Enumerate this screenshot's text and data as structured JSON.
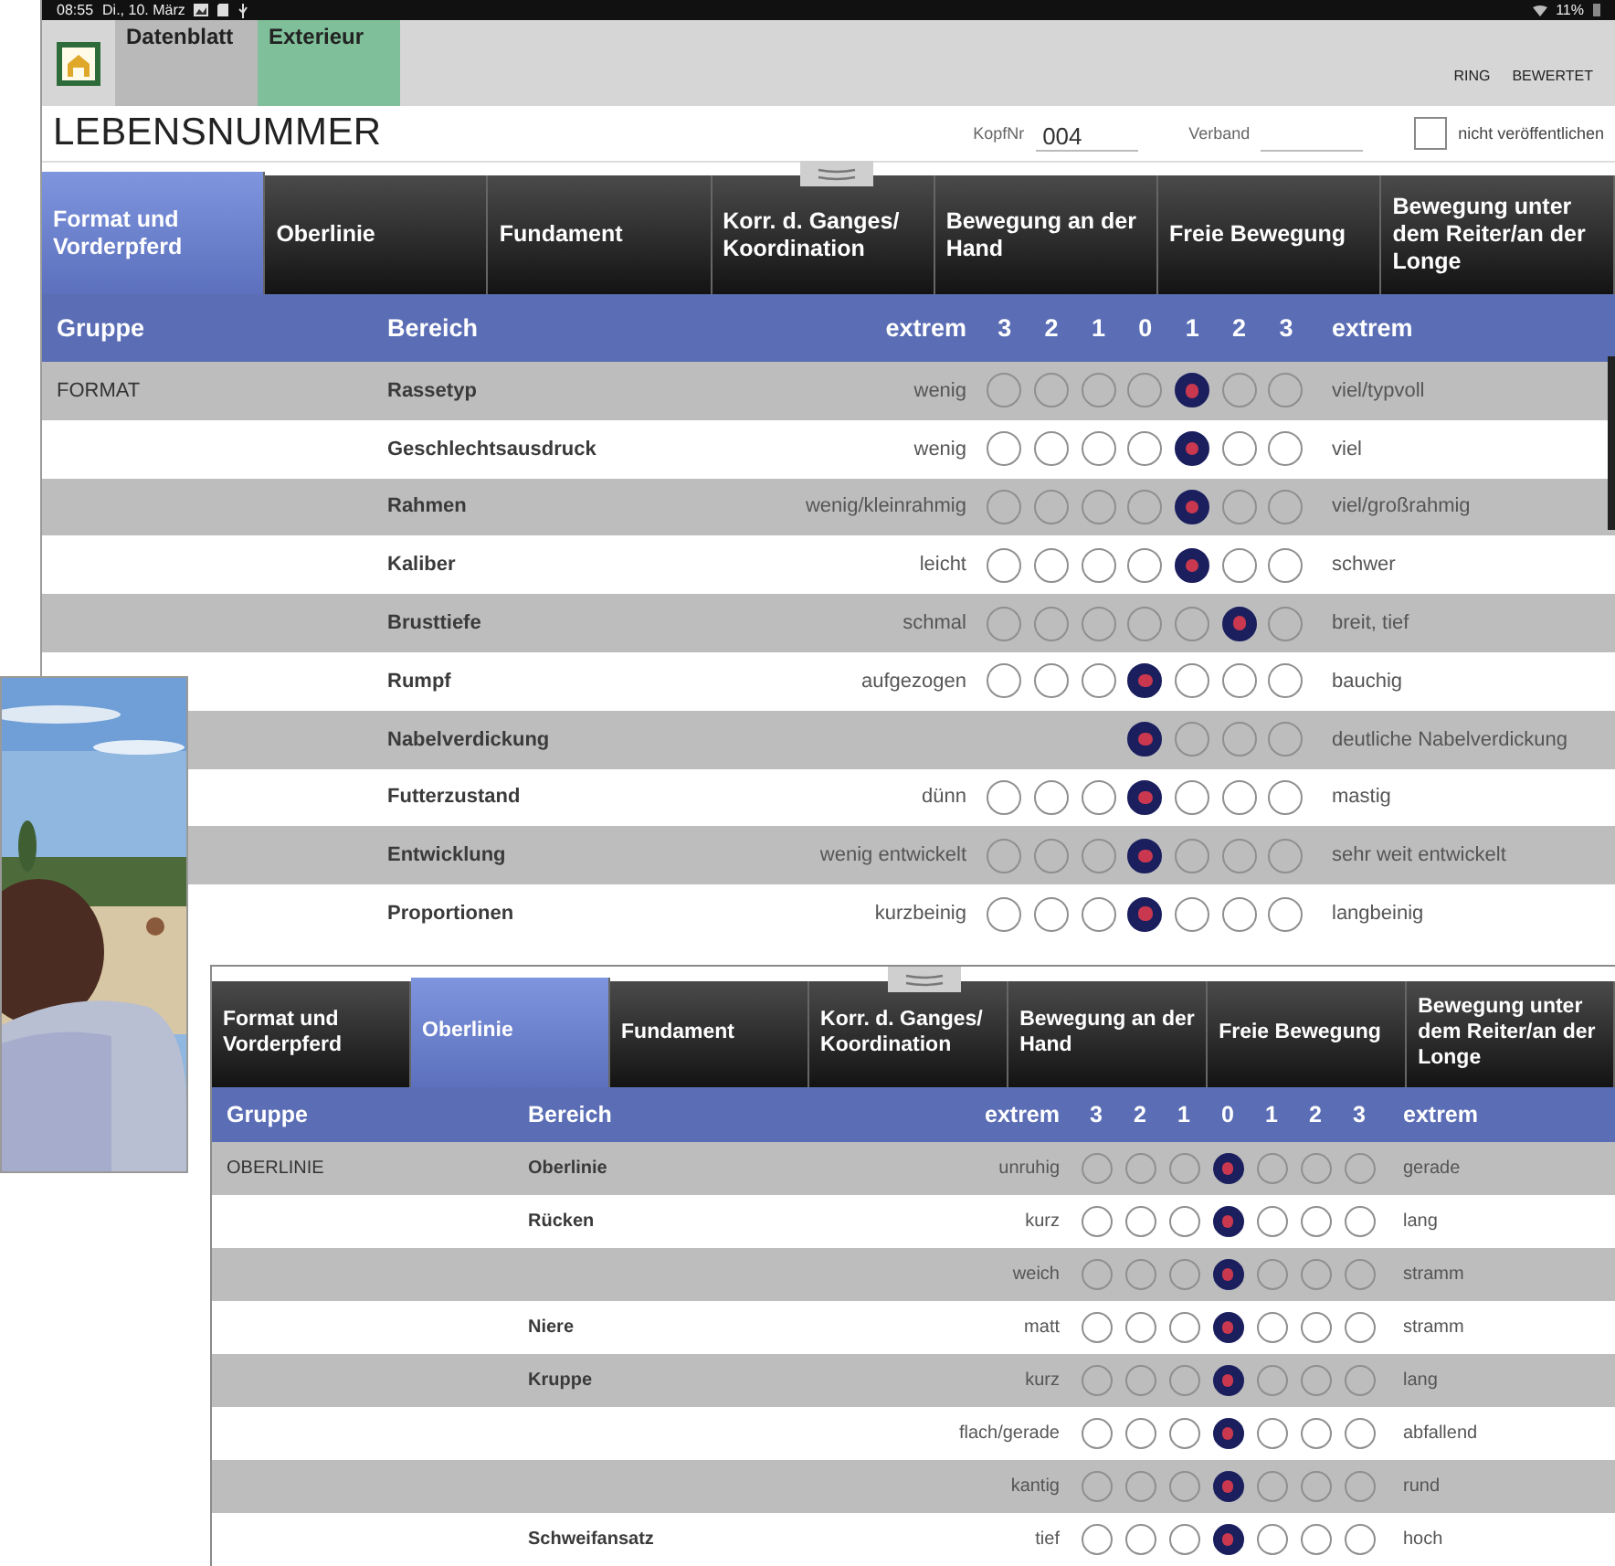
{
  "status_bar": {
    "time": "08:55",
    "date": "Di., 10. März",
    "battery": "11%"
  },
  "main_screen": {
    "app_bar": {
      "nav_tabs": [
        {
          "label": "Datenblatt",
          "selected": false
        },
        {
          "label": "Exterieur",
          "selected": true
        }
      ],
      "actions": [
        "RING",
        "BEWERTET"
      ]
    },
    "record": {
      "title": "LEBENSNUMMER",
      "kopfnr_label": "KopfNr",
      "kopfnr_value": "004",
      "verband_label": "Verband",
      "publish_checkbox": {
        "label": "nicht veröffentlichen",
        "checked": false
      }
    },
    "tabs": [
      {
        "label": "Format und Vorderpferd",
        "selected": true
      },
      {
        "label": "Oberlinie",
        "selected": false
      },
      {
        "label": "Fundament",
        "selected": false
      },
      {
        "label": "Korr. d. Ganges/ Koordination",
        "selected": false
      },
      {
        "label": "Bewegung an der Hand",
        "selected": false
      },
      {
        "label": "Freie Bewegung",
        "selected": false
      },
      {
        "label": "Bewegung unter dem Reiter/an der Longe",
        "selected": false
      }
    ],
    "table": {
      "header": {
        "group": "Gruppe",
        "area": "Bereich",
        "scale": [
          "extrem",
          "3",
          "2",
          "1",
          "0",
          "1",
          "2",
          "3",
          "extrem"
        ]
      },
      "rows": [
        {
          "group": "FORMAT",
          "area": "Rassetyp",
          "low": "wenig",
          "high": "viel/typvoll",
          "options": [
            {
              "selected": false
            },
            {
              "selected": false
            },
            {
              "selected": false
            },
            {
              "selected": false
            },
            {
              "selected": true
            },
            {
              "selected": false
            },
            {
              "selected": false
            }
          ]
        },
        {
          "area": "Geschlechtsausdruck",
          "low": "wenig",
          "high": "viel",
          "options": [
            {
              "selected": false
            },
            {
              "selected": false
            },
            {
              "selected": false
            },
            {
              "selected": false
            },
            {
              "selected": true
            },
            {
              "selected": false
            },
            {
              "selected": false
            }
          ]
        },
        {
          "area": "Rahmen",
          "low": "wenig/kleinrahmig",
          "high": "viel/großrahmig",
          "options": [
            {
              "selected": false
            },
            {
              "selected": false
            },
            {
              "selected": false
            },
            {
              "selected": false
            },
            {
              "selected": true
            },
            {
              "selected": false
            },
            {
              "selected": false
            }
          ]
        },
        {
          "area": "Kaliber",
          "low": "leicht",
          "high": "schwer",
          "options": [
            {
              "selected": false
            },
            {
              "selected": false
            },
            {
              "selected": false
            },
            {
              "selected": false
            },
            {
              "selected": true
            },
            {
              "selected": false
            },
            {
              "selected": false
            }
          ]
        },
        {
          "area": "Brusttiefe",
          "low": "schmal",
          "high": "breit, tief",
          "options": [
            {
              "selected": false
            },
            {
              "selected": false
            },
            {
              "selected": false
            },
            {
              "selected": false
            },
            {
              "selected": false
            },
            {
              "selected": true
            },
            {
              "selected": false
            }
          ]
        },
        {
          "area": "Rumpf",
          "low": "aufgezogen",
          "high": "bauchig",
          "options": [
            {
              "selected": false
            },
            {
              "selected": false
            },
            {
              "selected": false
            },
            {
              "selected": true
            },
            {
              "selected": false
            },
            {
              "selected": false
            },
            {
              "selected": false
            }
          ]
        },
        {
          "area": "Nabelverdickung",
          "high": "deutliche Nabelverdickung",
          "options": [
            {
              "selected": true
            },
            {
              "selected": false
            },
            {
              "selected": false
            },
            {
              "selected": false
            }
          ]
        },
        {
          "area": "Futterzustand",
          "low": "dünn",
          "high": "mastig",
          "options": [
            {
              "selected": false
            },
            {
              "selected": false
            },
            {
              "selected": false
            },
            {
              "selected": true
            },
            {
              "selected": false
            },
            {
              "selected": false
            },
            {
              "selected": false
            }
          ]
        },
        {
          "area": "Entwicklung",
          "low": "wenig entwickelt",
          "high": "sehr weit entwickelt",
          "options": [
            {
              "selected": false
            },
            {
              "selected": false
            },
            {
              "selected": false
            },
            {
              "selected": true
            },
            {
              "selected": false
            },
            {
              "selected": false
            },
            {
              "selected": false
            }
          ]
        },
        {
          "area": "Proportionen",
          "low": "kurzbeinig",
          "high": "langbeinig",
          "options": [
            {
              "selected": false
            },
            {
              "selected": false
            },
            {
              "selected": false
            },
            {
              "selected": true
            },
            {
              "selected": false
            },
            {
              "selected": false
            },
            {
              "selected": false
            }
          ]
        }
      ]
    }
  },
  "overlay_screen": {
    "tabs": [
      {
        "label": "Format und Vorderpferd",
        "selected": false
      },
      {
        "label": "Oberlinie",
        "selected": true
      },
      {
        "label": "Fundament",
        "selected": false
      },
      {
        "label": "Korr. d. Ganges/ Koordination",
        "selected": false
      },
      {
        "label": "Bewegung an der Hand",
        "selected": false
      },
      {
        "label": "Freie Bewegung",
        "selected": false
      },
      {
        "label": "Bewegung unter dem Reiter/an der Longe",
        "selected": false
      }
    ],
    "table": {
      "header": {
        "group": "Gruppe",
        "area": "Bereich",
        "scale": [
          "extrem",
          "3",
          "2",
          "1",
          "0",
          "1",
          "2",
          "3",
          "extrem"
        ]
      },
      "rows": [
        {
          "group": "OBERLINIE",
          "area": "Oberlinie",
          "low": "unruhig",
          "high": "gerade",
          "options": [
            {
              "selected": false
            },
            {
              "selected": false
            },
            {
              "selected": false
            },
            {
              "selected": true
            },
            {
              "selected": false
            },
            {
              "selected": false
            },
            {
              "selected": false
            }
          ]
        },
        {
          "area": "Rücken",
          "low": "kurz",
          "high": "lang",
          "options": [
            {
              "selected": false
            },
            {
              "selected": false
            },
            {
              "selected": false
            },
            {
              "selected": true
            },
            {
              "selected": false
            },
            {
              "selected": false
            },
            {
              "selected": false
            }
          ]
        },
        {
          "low": "weich",
          "high": "stramm",
          "options": [
            {
              "selected": false
            },
            {
              "selected": false
            },
            {
              "selected": false
            },
            {
              "selected": true
            },
            {
              "selected": false
            },
            {
              "selected": false
            },
            {
              "selected": false
            }
          ]
        },
        {
          "area": "Niere",
          "low": "matt",
          "high": "stramm",
          "options": [
            {
              "selected": false
            },
            {
              "selected": false
            },
            {
              "selected": false
            },
            {
              "selected": true
            },
            {
              "selected": false
            },
            {
              "selected": false
            },
            {
              "selected": false
            }
          ]
        },
        {
          "area": "Kruppe",
          "low": "kurz",
          "high": "lang",
          "options": [
            {
              "selected": false
            },
            {
              "selected": false
            },
            {
              "selected": false
            },
            {
              "selected": true
            },
            {
              "selected": false
            },
            {
              "selected": false
            },
            {
              "selected": false
            }
          ]
        },
        {
          "low": "flach/gerade",
          "high": "abfallend",
          "options": [
            {
              "selected": false
            },
            {
              "selected": false
            },
            {
              "selected": false
            },
            {
              "selected": true
            },
            {
              "selected": false
            },
            {
              "selected": false
            },
            {
              "selected": false
            }
          ]
        },
        {
          "low": "kantig",
          "high": "rund",
          "options": [
            {
              "selected": false
            },
            {
              "selected": false
            },
            {
              "selected": false
            },
            {
              "selected": true
            },
            {
              "selected": false
            },
            {
              "selected": false
            },
            {
              "selected": false
            }
          ]
        },
        {
          "area": "Schweifansatz",
          "low": "tief",
          "high": "hoch",
          "options": [
            {
              "selected": false
            },
            {
              "selected": false
            },
            {
              "selected": false
            },
            {
              "selected": true
            },
            {
              "selected": false
            },
            {
              "selected": false
            },
            {
              "selected": false
            }
          ]
        }
      ]
    }
  }
}
